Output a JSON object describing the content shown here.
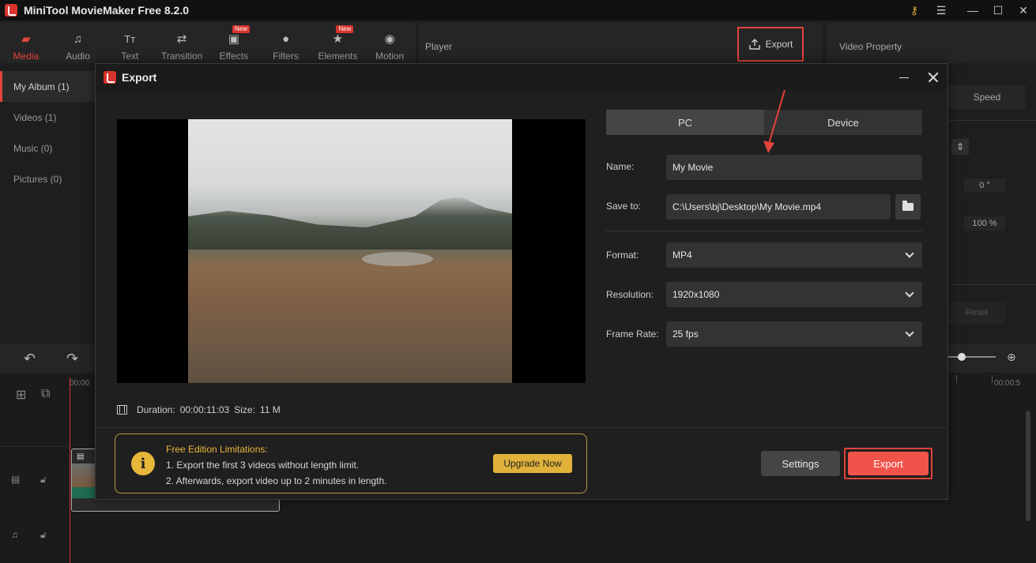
{
  "app": {
    "title": "MiniTool MovieMaker Free 8.2.0"
  },
  "toolbar": {
    "items": [
      {
        "label": "Media",
        "active": true,
        "icon": "folder-icon"
      },
      {
        "label": "Audio",
        "icon": "music-note-icon"
      },
      {
        "label": "Text",
        "icon": "text-icon"
      },
      {
        "label": "Transition",
        "icon": "transition-icon"
      },
      {
        "label": "Effects",
        "icon": "effects-icon",
        "badge": "New"
      },
      {
        "label": "Filters",
        "icon": "filters-icon"
      },
      {
        "label": "Elements",
        "icon": "elements-icon",
        "badge": "New"
      },
      {
        "label": "Motion",
        "icon": "motion-icon"
      }
    ]
  },
  "player": {
    "title": "Player",
    "export_label": "Export"
  },
  "video_property": {
    "title": "Video Property",
    "speed_label": "Speed",
    "rotation_value": "0 °",
    "scale_value": "100 %",
    "reset_label": "Reset"
  },
  "media": {
    "items": [
      {
        "label": "My Album (1)",
        "active": true
      },
      {
        "label": "Videos (1)"
      },
      {
        "label": "Music (0)"
      },
      {
        "label": "Pictures (0)"
      }
    ]
  },
  "timeline": {
    "start_tick": "00:00",
    "end_tick": "00:00:5"
  },
  "dialog": {
    "title": "Export",
    "tabs": [
      {
        "label": "PC",
        "active": true
      },
      {
        "label": "Device"
      }
    ],
    "name_label": "Name:",
    "name_value": "My Movie",
    "save_label": "Save to:",
    "save_value": "C:\\Users\\bj\\Desktop\\My Movie.mp4",
    "format_label": "Format:",
    "format_value": "MP4",
    "resolution_label": "Resolution:",
    "resolution_value": "1920x1080",
    "framerate_label": "Frame Rate:",
    "framerate_value": "25 fps",
    "duration_label": "Duration:",
    "duration_value": "00:00:11:03",
    "size_label": "Size:",
    "size_value": "11 M",
    "limit_title": "Free Edition Limitations:",
    "limit_line1": "1. Export the first 3 videos without length limit.",
    "limit_line2": "2. Afterwards, export video up to 2 minutes in length.",
    "upgrade_label": "Upgrade Now",
    "settings_label": "Settings",
    "export_label": "Export"
  },
  "colors": {
    "accent": "#e2433b",
    "gold": "#e0b23a",
    "bg": "#1e1e1e"
  }
}
